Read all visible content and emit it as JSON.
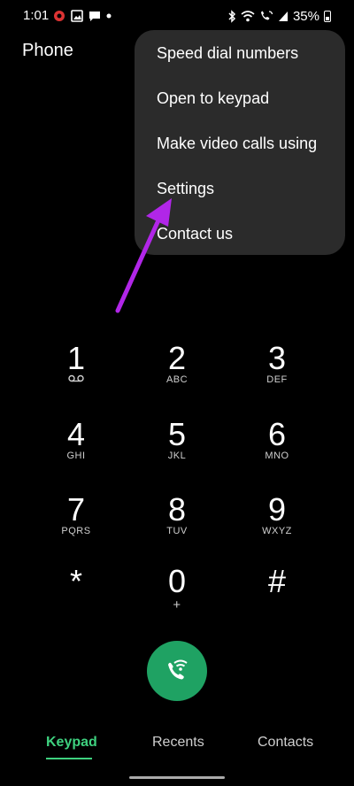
{
  "status_bar": {
    "time": "1:01",
    "battery_percent": "35%",
    "left_icons": [
      "notification-app-icon",
      "image-icon",
      "message-icon",
      "dot-icon"
    ],
    "right_icons": [
      "bluetooth-icon",
      "wifi-icon",
      "wifi-calling-icon",
      "signal-icon",
      "battery-icon"
    ]
  },
  "header": {
    "title": "Phone"
  },
  "overflow_menu": {
    "items": [
      {
        "label": "Speed dial numbers"
      },
      {
        "label": "Open to keypad"
      },
      {
        "label": "Make video calls using"
      },
      {
        "label": "Settings"
      },
      {
        "label": "Contact us"
      }
    ]
  },
  "annotation": {
    "arrow_color": "#b126e8",
    "points_to": "Settings"
  },
  "keypad": {
    "keys": [
      {
        "digit": "1",
        "letters": "",
        "sub_icon": "voicemail-icon"
      },
      {
        "digit": "2",
        "letters": "ABC"
      },
      {
        "digit": "3",
        "letters": "DEF"
      },
      {
        "digit": "4",
        "letters": "GHI"
      },
      {
        "digit": "5",
        "letters": "JKL"
      },
      {
        "digit": "6",
        "letters": "MNO"
      },
      {
        "digit": "7",
        "letters": "PQRS"
      },
      {
        "digit": "8",
        "letters": "TUV"
      },
      {
        "digit": "9",
        "letters": "WXYZ"
      },
      {
        "digit": "*",
        "letters": ""
      },
      {
        "digit": "0",
        "letters": "+"
      },
      {
        "digit": "#",
        "letters": ""
      }
    ]
  },
  "call_button": {
    "icon": "wifi-call-icon",
    "color": "#1fa263"
  },
  "bottom_nav": {
    "tabs": [
      {
        "label": "Keypad",
        "active": true
      },
      {
        "label": "Recents",
        "active": false
      },
      {
        "label": "Contacts",
        "active": false
      }
    ],
    "accent": "#3ed17f"
  }
}
